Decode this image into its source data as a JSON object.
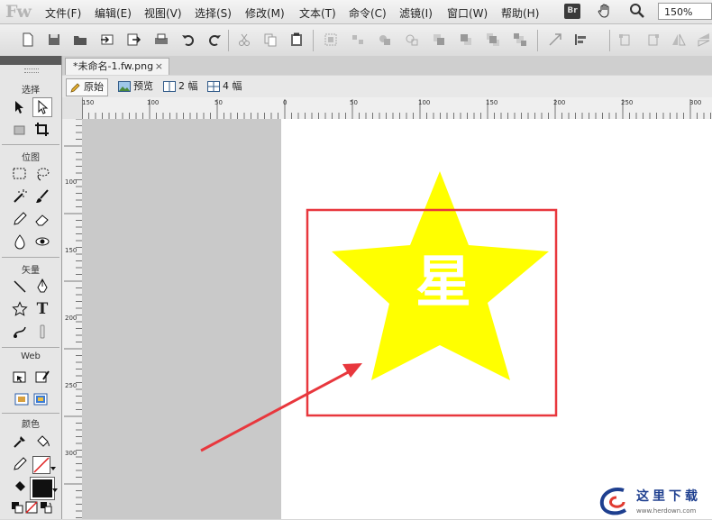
{
  "app": {
    "logo": "Fw"
  },
  "menu": [
    "文件(F)",
    "编辑(E)",
    "视图(V)",
    "选择(S)",
    "修改(M)",
    "文本(T)",
    "命令(C)",
    "滤镜(I)",
    "窗口(W)",
    "帮助(H)"
  ],
  "bridge_label": "Br",
  "zoom": "150%",
  "document": {
    "tab_title": "*未命名-1.fw.png",
    "close_glyph": "×"
  },
  "view_tabs": [
    "原始",
    "预览",
    "2 幅",
    "4 幅"
  ],
  "tools": {
    "sections": [
      "选择",
      "位图",
      "矢量",
      "Web",
      "颜色"
    ],
    "text_tool": "T"
  },
  "ruler": {
    "horizontal": [
      "150",
      "100",
      "50",
      "0",
      "50",
      "100",
      "150",
      "200",
      "250",
      "300"
    ],
    "vertical": [
      "100",
      "150",
      "200",
      "250",
      "300"
    ]
  },
  "canvas": {
    "star_text": "星",
    "star_color": "#ffff00",
    "highlight_color": "#e8373d",
    "arrow_color": "#e8373d"
  },
  "watermark": {
    "text": "这里下载",
    "url": "www.herdown.com"
  },
  "colors": {
    "accent": "#1e3f8f"
  }
}
